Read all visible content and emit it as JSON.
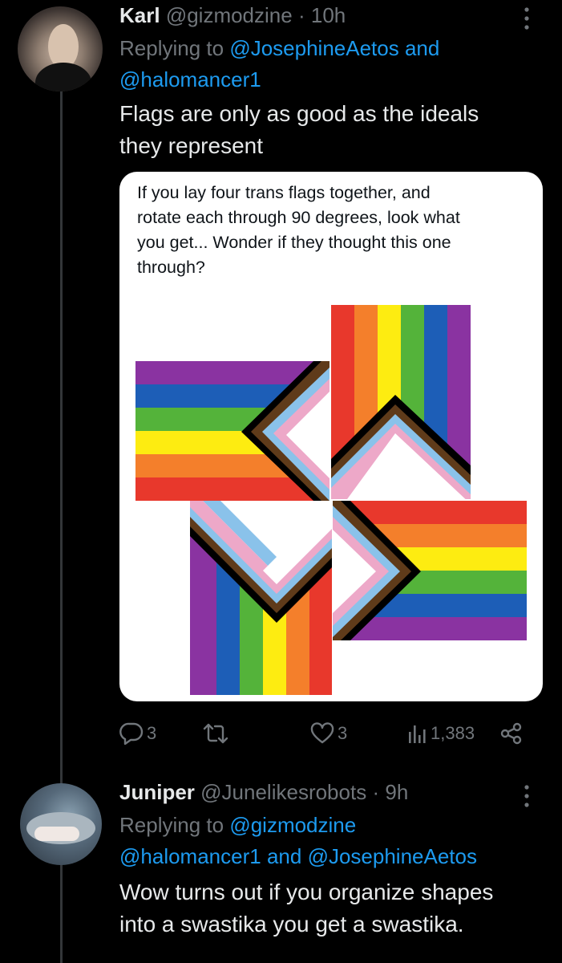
{
  "tweets": [
    {
      "name": "Karl",
      "handle": "@gizmodzine",
      "dot": "·",
      "time": "10h",
      "replying_prefix": "Replying to",
      "mention1": "@JosephineAetos",
      "and": "and",
      "mention2": "@halomancer1",
      "text_line1": "Flags are only as good as the ideals",
      "text_line2": "they represent",
      "media": {
        "line1": "If you lay four trans flags together, and",
        "line2": "rotate each through 90 degrees, look what",
        "line3": "you get... Wonder if they thought this one",
        "line4": "through?"
      },
      "actions": {
        "replies": "3",
        "reposts": "",
        "likes": "3",
        "views": "1,383"
      }
    },
    {
      "name": "Juniper",
      "handle": "@Junelikesrobots",
      "dot": "·",
      "time": "9h",
      "replying_prefix": "Replying to",
      "mention1": "@gizmodzine",
      "mention2": "@halomancer1",
      "and": "and",
      "mention3": "@JosephineAetos",
      "text_line1": "Wow turns out if you organize shapes",
      "text_line2": "into a swastika you get a swastika."
    }
  ],
  "icons": [
    "more-icon",
    "reply-icon",
    "repost-icon",
    "like-icon",
    "views-icon",
    "share-icon"
  ],
  "colors": {
    "link": "#1d9bf0",
    "muted": "#71767b",
    "text": "#e7e9ea",
    "flag_red": "#e8382c",
    "flag_orange": "#f47f2b",
    "flag_yellow": "#fdec11",
    "flag_green": "#54b33a",
    "flag_blue": "#1d5eb7",
    "flag_purple": "#8a33a1",
    "trans_blue": "#8ac2ea",
    "trans_pink": "#eda8c8",
    "flag_brown": "#5f3b1a",
    "flag_black": "#000000"
  }
}
